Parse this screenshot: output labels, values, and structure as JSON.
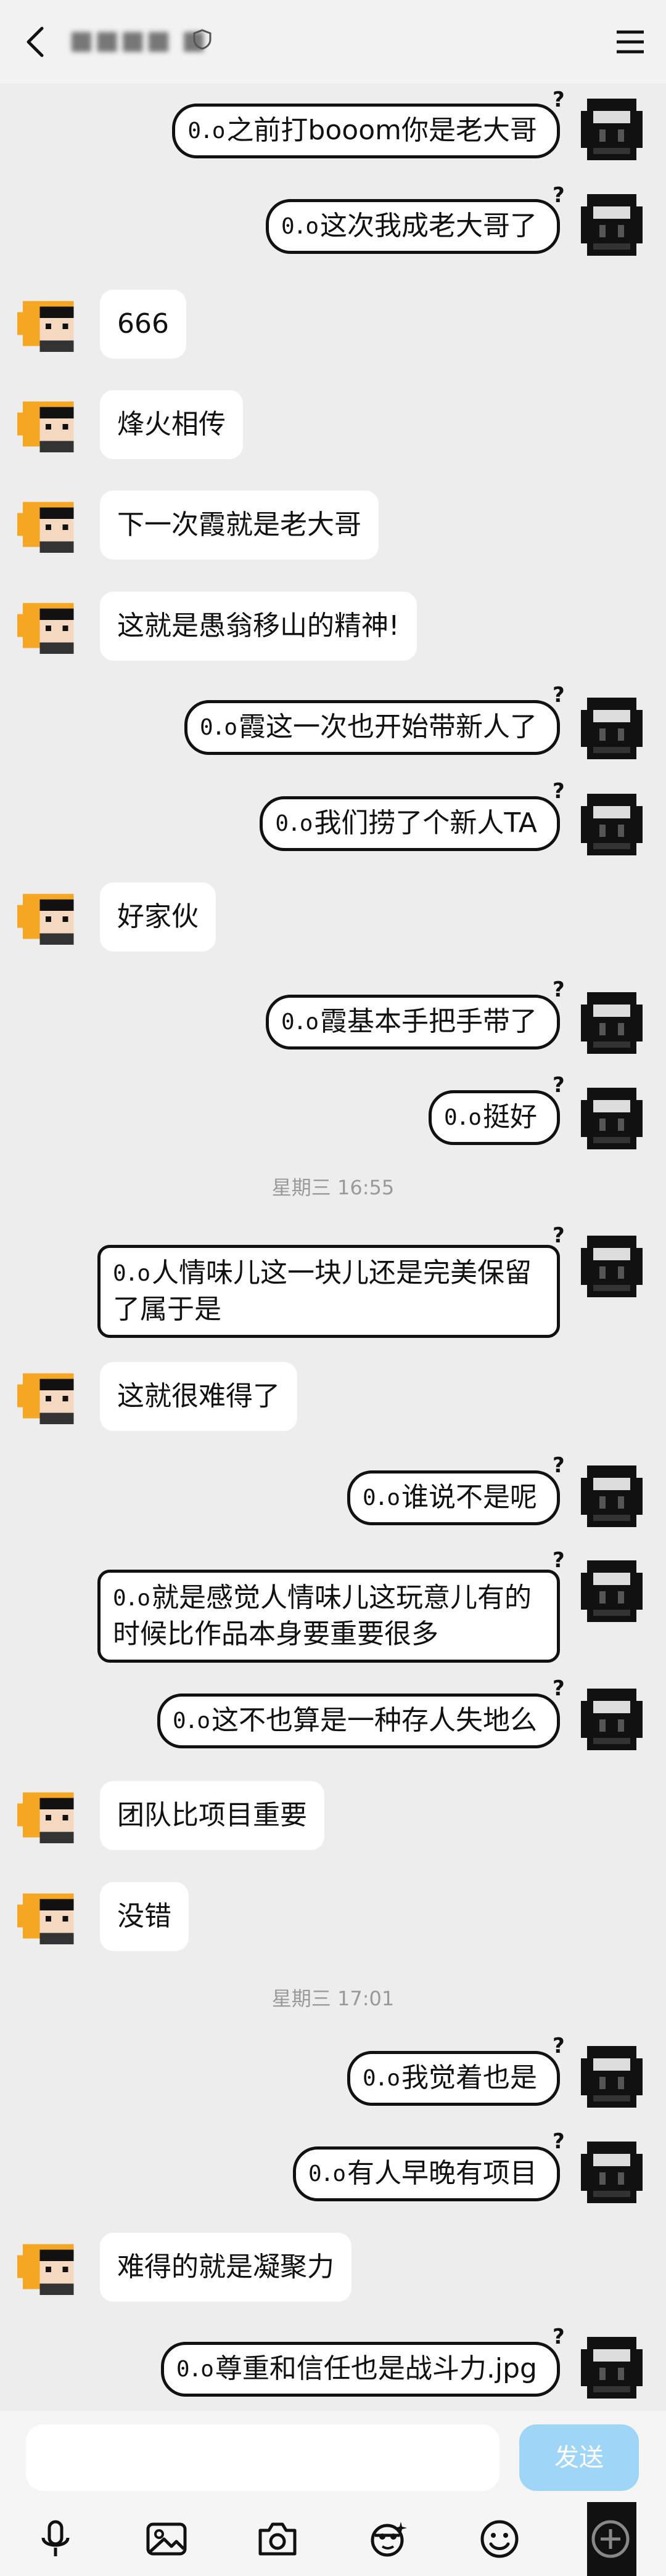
{
  "header": {
    "title": "■■■■ ■",
    "back_icon": "chevron-left-icon",
    "menu_icon": "hamburger-menu-icon"
  },
  "oo": "0.o",
  "messages": [
    {
      "side": "out",
      "text": "之前打booom你是老大哥"
    },
    {
      "side": "out",
      "text": "这次我成老大哥了"
    },
    {
      "side": "in",
      "text": "666"
    },
    {
      "side": "in",
      "text": "烽火相传"
    },
    {
      "side": "in",
      "text": "下一次霞就是老大哥"
    },
    {
      "side": "in",
      "text": "这就是愚翁移山的精神!"
    },
    {
      "side": "out",
      "text": "霞这一次也开始带新人了"
    },
    {
      "side": "out",
      "text": "我们捞了个新人TA"
    },
    {
      "side": "in",
      "text": "好家伙"
    },
    {
      "side": "out",
      "text": "霞基本手把手带了"
    },
    {
      "side": "out",
      "text": "挺好"
    },
    {
      "side": "out",
      "text": "人情味儿这一块儿还是完美保留了属于是"
    },
    {
      "side": "in",
      "text": "这就很难得了"
    },
    {
      "side": "out",
      "text": "谁说不是呢"
    },
    {
      "side": "out",
      "text": "就是感觉人情味儿这玩意儿有的时候比作品本身要重要很多"
    },
    {
      "side": "out",
      "text": "这不也算是一种存人失地么"
    },
    {
      "side": "in",
      "text": "团队比项目重要"
    },
    {
      "side": "in",
      "text": "没错"
    },
    {
      "side": "out",
      "text": "我觉着也是"
    },
    {
      "side": "out",
      "text": "有人早晚有项目"
    },
    {
      "side": "in",
      "text": "难得的就是凝聚力"
    },
    {
      "side": "out",
      "text": "尊重和信任也是战斗力.jpg"
    }
  ],
  "timestamps": [
    "星期三 16:55",
    "星期三 17:01"
  ],
  "composer": {
    "send_label": "发送",
    "placeholder": ""
  },
  "toolbar": [
    "microphone-icon",
    "image-icon",
    "camera-icon",
    "sticker-icon",
    "emoji-icon",
    "plus-icon"
  ],
  "colors": {
    "background": "#ededed",
    "send": "#9fd6f7",
    "avatar_orange": "#f5a623"
  }
}
